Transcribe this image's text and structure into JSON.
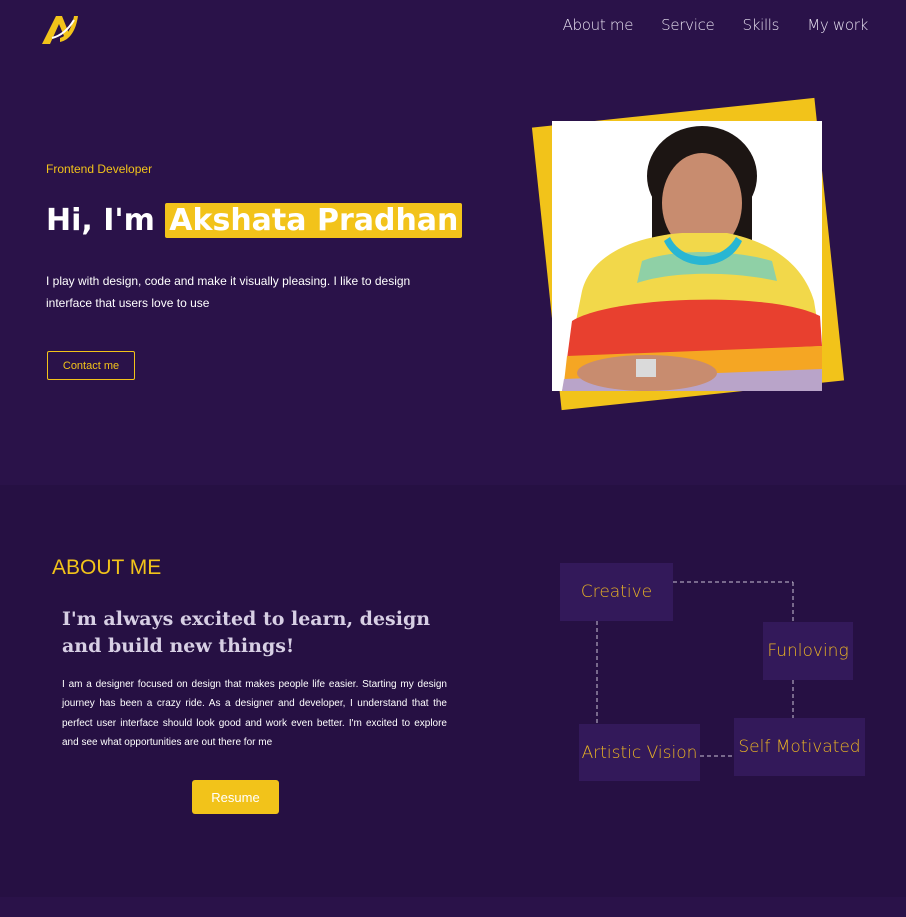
{
  "nav": {
    "items": [
      "About me",
      "Service",
      "Skills",
      "My work"
    ]
  },
  "hero": {
    "role": "Frontend Developer",
    "greeting": "Hi, I'm",
    "name": "Akshata Pradhan",
    "intro": "I play with design, code and make it visually pleasing. I like to design interface that users love to use",
    "contact_label": "Contact me"
  },
  "about": {
    "title": "ABOUT ME",
    "lead": "I'm always excited to learn, design and build new things!",
    "body": "I am a designer focused on design that makes people life easier. Starting my design journey has been a crazy ride. As a designer and developer, I understand that the perfect user interface should look good and work even better. I'm excited to explore and see what opportunities are out there for me",
    "resume_label": "Resume",
    "traits": [
      "Creative",
      "Funloving",
      "Artistic Vision",
      "Self Motivated"
    ]
  },
  "colors": {
    "background": "#2a1249",
    "section_background": "#261043",
    "accent": "#f2c31a",
    "trait_box": "#33195a"
  },
  "icons": {
    "logo": "logo-mark-icon"
  }
}
